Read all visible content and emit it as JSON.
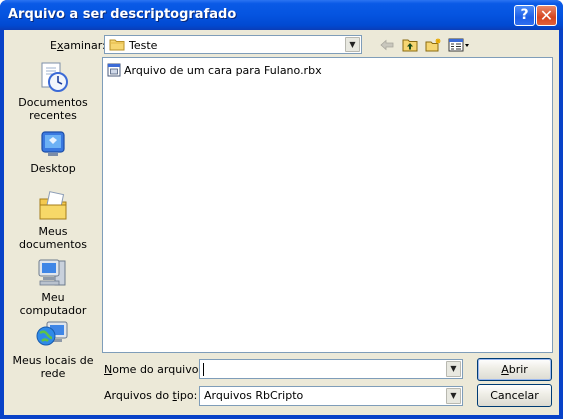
{
  "window": {
    "title": "Arquivo a ser descriptografado",
    "help_glyph": "?",
    "close_glyph": "✕"
  },
  "lookin": {
    "label_pre": "E",
    "label_underlined": "x",
    "label_post": "aminar:",
    "value": "Teste",
    "toolbar_icons": [
      "back-arrow-icon",
      "up-folder-icon",
      "new-folder-icon",
      "view-menu-icon"
    ]
  },
  "places": [
    {
      "label_line1": "Documentos",
      "label_line2": "recentes",
      "icon": "recent-documents-icon"
    },
    {
      "label_line1": "Desktop",
      "label_line2": "",
      "icon": "desktop-icon"
    },
    {
      "label_line1": "Meus",
      "label_line2": "documentos",
      "icon": "my-documents-icon"
    },
    {
      "label_line1": "Meu computador",
      "label_line2": "",
      "icon": "my-computer-icon"
    },
    {
      "label_line1": "Meus locais de",
      "label_line2": "rede",
      "icon": "network-places-icon"
    }
  ],
  "files": [
    {
      "name": "Arquivo de um cara para Fulano.rbx",
      "icon": "rbx-file-icon"
    }
  ],
  "filename": {
    "label_underlined": "N",
    "label_post": "ome do arquivo:",
    "value": ""
  },
  "filetype": {
    "label_pre": "Arquivos do ",
    "label_underlined": "t",
    "label_post": "ipo:",
    "value": "Arquivos RbCripto"
  },
  "buttons": {
    "open_underlined": "A",
    "open_post": "brir",
    "cancel": "Cancelar"
  },
  "colors": {
    "titlebar": "#0554e0",
    "client_bg": "#ece9d8",
    "field_border": "#7f9db9"
  }
}
